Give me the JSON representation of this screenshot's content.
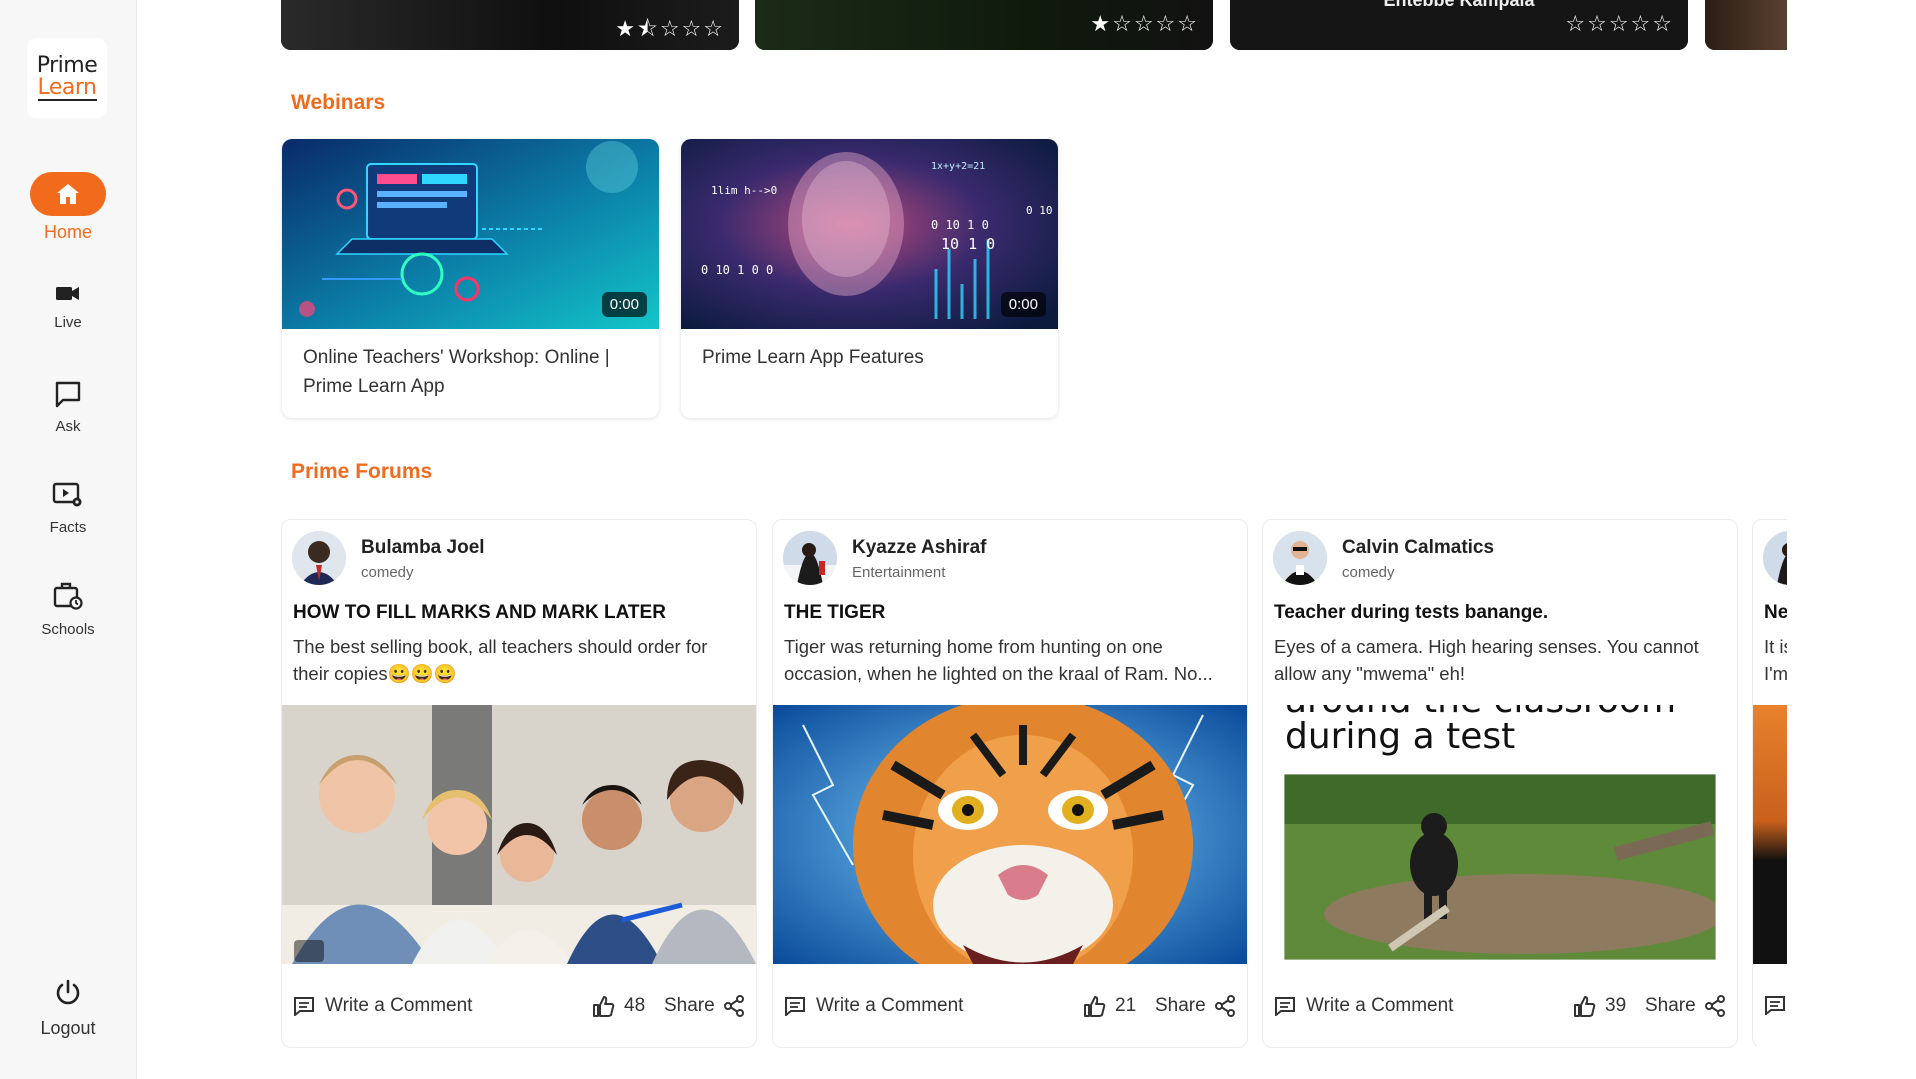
{
  "brand": {
    "line1": "Prime",
    "line2": "Learn"
  },
  "nav": {
    "home": "Home",
    "live": "Live",
    "ask": "Ask",
    "facts": "Facts",
    "schools": "Schools",
    "logout": "Logout"
  },
  "top_cards": [
    {
      "stars": "★⯪☆☆☆"
    },
    {
      "stars": "★☆☆☆☆"
    },
    {
      "title": "Entebbe Kampala",
      "stars": "☆☆☆☆☆"
    }
  ],
  "sections": {
    "webinars": "Webinars",
    "forums": "Prime Forums"
  },
  "webinars": [
    {
      "title": "Online Teachers' Workshop: Online | Prime Learn App",
      "duration": "0:00"
    },
    {
      "title": "Prime Learn App Features",
      "duration": "0:00"
    }
  ],
  "forum_actions": {
    "comment": "Write a Comment",
    "share": "Share"
  },
  "posts": [
    {
      "author": "Bulamba Joel",
      "category": "comedy",
      "title": "HOW TO FILL MARKS AND MARK LATER",
      "body": "The best selling book, all teachers should order for their copies😀😀😀",
      "likes": "48"
    },
    {
      "author": "Kyazze Ashiraf",
      "category": "Entertainment",
      "title": "THE TIGER",
      "body": "Tiger  was returning home from hunting on one occasion, when he lighted on the kraal of Ram. No...",
      "likes": "21"
    },
    {
      "author": "Calvin Calmatics",
      "category": "comedy",
      "title": "Teacher during tests banange.",
      "body": "Eyes of a camera. High hearing senses. You cannot allow any \"mwema\" eh!",
      "image_text_top": "around the classroom",
      "image_text": "during a test",
      "likes": "39"
    },
    {
      "title": "New",
      "body_line1": "It is",
      "body_line2": "I'm"
    }
  ],
  "colors": {
    "accent": "#f26b1d",
    "sidebar_bg": "#f7f7f7"
  }
}
